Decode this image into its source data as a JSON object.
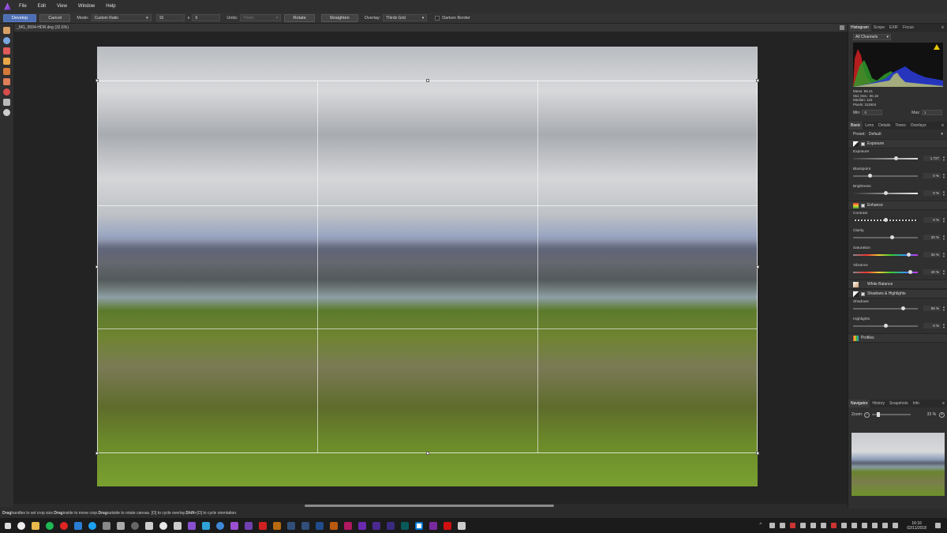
{
  "menu": [
    "File",
    "Edit",
    "View",
    "Window",
    "Help"
  ],
  "toolbar": {
    "develop": "Develop",
    "cancel": "Cancel",
    "mode_label": "Mode:",
    "mode_value": "Custom Ratio",
    "width": "16",
    "x": "x",
    "height": "9",
    "units_label": "Units:",
    "units_value": "Pixels",
    "rotate": "Rotate",
    "straighten": "Straighten",
    "overlay_label": "Overlay:",
    "overlay_value": "Thirds Grid",
    "darken": "Darken Border"
  },
  "document": {
    "title": "_MG_9594-HDR.dng (32.6%)"
  },
  "status": {
    "w1": "Drag",
    "t1": " handles to set crop size. ",
    "w2": "Drag",
    "t2": " inside to move crop. ",
    "w3": "Drag",
    "t3": " outside to rotate canvas. [O] to cycle overlay. ",
    "w4": "Shift",
    "t4": "+[O] to cycle orientation."
  },
  "histogram_panel": {
    "tabs": [
      "Histogram",
      "Scope",
      "EXIF",
      "Focus"
    ],
    "channel": "All Channels",
    "stats": [
      "Mean: 55.41",
      "Std. Dev.: 55.18",
      "Median: 115",
      "Pixels: 311904"
    ],
    "min_label": "Min:",
    "min_value": "0",
    "max_label": "Max:",
    "max_value": "1"
  },
  "develop_panel": {
    "tabs": [
      "Basic",
      "Lens",
      "Details",
      "Tones",
      "Overlays"
    ],
    "preset_label": "Preset:",
    "preset_value": "Default",
    "exposure_section": "Exposure",
    "exposure": {
      "label": "Exposure",
      "value": "1.727",
      "level": 0.66
    },
    "blackpoint": {
      "label": "Blackpoint",
      "value": "0 %",
      "level": 0.26
    },
    "brightness": {
      "label": "Brightness",
      "value": "0 %",
      "level": 0.5
    },
    "enhance_section": "Enhance",
    "contrast": {
      "label": "Contrast",
      "value": "0 %",
      "level": 0.5
    },
    "clarity": {
      "label": "Clarity",
      "value": "20 %",
      "level": 0.6
    },
    "saturation": {
      "label": "Saturation",
      "value": "34 %",
      "level": 0.86
    },
    "vibrance": {
      "label": "Vibrance",
      "value": "40 %",
      "level": 0.88
    },
    "white_balance_section": "White Balance",
    "shadows_section": "Shadows & Highlights",
    "shadows": {
      "label": "Shadows",
      "value": "56 %",
      "level": 0.78
    },
    "highlights": {
      "label": "Highlights",
      "value": "0 %",
      "level": 0.5
    },
    "profiles_section": "Profiles"
  },
  "navigator_panel": {
    "tabs": [
      "Navigator",
      "History",
      "Snapshots",
      "Info"
    ],
    "zoom_label": "Zoom:",
    "zoom_value": "33 %"
  },
  "clock": {
    "time": "16:16",
    "date": "02/11/2018"
  },
  "colors": {
    "accent": "#4e6fb3",
    "panel": "#303030",
    "canvas": "#232323"
  }
}
